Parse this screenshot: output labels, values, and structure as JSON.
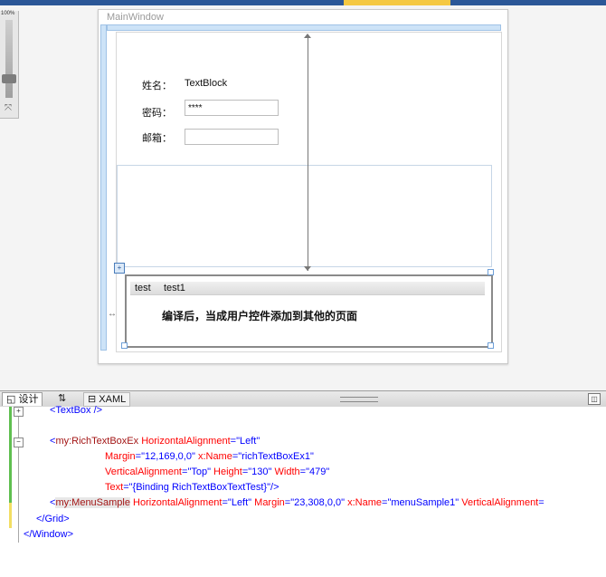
{
  "zoom": {
    "label": "100%"
  },
  "designer": {
    "window_title": "MainWindow",
    "name_label": "姓名：",
    "name_value": "TextBlock",
    "password_label": "密码：",
    "password_value": "****",
    "email_label": "邮箱：",
    "email_value": "",
    "menu_items": [
      "test",
      "test1"
    ],
    "menu_text": "编译后，当成用户控件添加到其他的页面"
  },
  "tabs": {
    "design": "设计",
    "swap": "⇅",
    "xaml": "XAML"
  },
  "code": {
    "line1": "<TextBox",
    "line1_tail": "/>",
    "line2_open": "<",
    "line2_tag": "my:RichTextBoxEx",
    "line2_a1": "HorizontalAlignment",
    "line2_v1": "\"Left\"",
    "line3_a1": "Margin",
    "line3_v1": "\"12,169,0,0\"",
    "line3_a2": "x:Name",
    "line3_v2": "\"richTextBoxEx1\"",
    "line4_a1": "VerticalAlignment",
    "line4_v1": "\"Top\"",
    "line4_a2": "Height",
    "line4_v2": "\"130\"",
    "line4_a3": "Width",
    "line4_v3": "\"479\"",
    "line5_a1": "Text",
    "line5_v1": "\"{Binding RichTextBoxTextTest}\"",
    "line5_close": "/>",
    "line6_tag": "my:MenuSample",
    "line6_a1": "HorizontalAlignment",
    "line6_v1": "\"Left\"",
    "line6_a2": "Margin",
    "line6_v2": "\"23,308,0,0\"",
    "line6_a3": "x:Name",
    "line6_v3": "\"menuSample1\"",
    "line6_a4": "VerticalAlignment",
    "line7": "</Grid>",
    "line8": "</Window>"
  }
}
